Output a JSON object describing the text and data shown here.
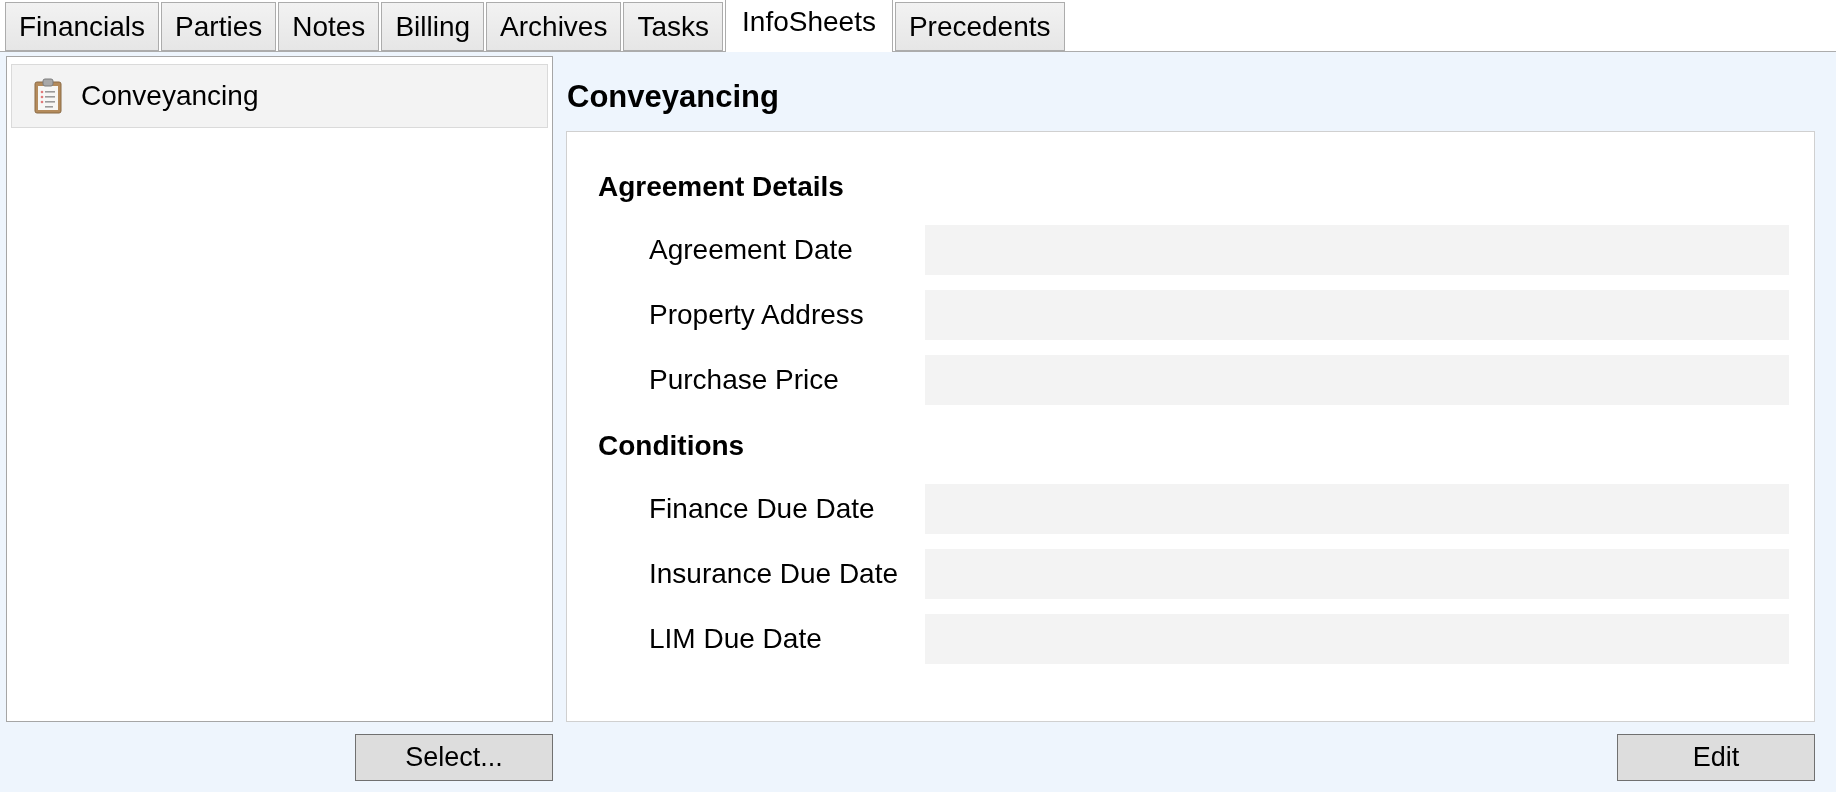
{
  "tabs": [
    {
      "label": "Financials",
      "selected": false
    },
    {
      "label": "Parties",
      "selected": false
    },
    {
      "label": "Notes",
      "selected": false
    },
    {
      "label": "Billing",
      "selected": false
    },
    {
      "label": "Archives",
      "selected": false
    },
    {
      "label": "Tasks",
      "selected": false
    },
    {
      "label": "InfoSheets",
      "selected": true
    },
    {
      "label": "Precedents",
      "selected": false
    }
  ],
  "list": {
    "items": [
      {
        "label": "Conveyancing",
        "selected": true
      }
    ],
    "select_button": "Select..."
  },
  "detail": {
    "title": "Conveyancing",
    "sections": [
      {
        "heading": "Agreement Details",
        "fields": [
          {
            "label": "Agreement Date"
          },
          {
            "label": "Property Address"
          },
          {
            "label": "Purchase Price"
          }
        ]
      },
      {
        "heading": "Conditions",
        "fields": [
          {
            "label": "Finance Due Date"
          },
          {
            "label": "Insurance Due Date"
          },
          {
            "label": "LIM Due Date"
          }
        ]
      }
    ],
    "edit_button": "Edit"
  }
}
